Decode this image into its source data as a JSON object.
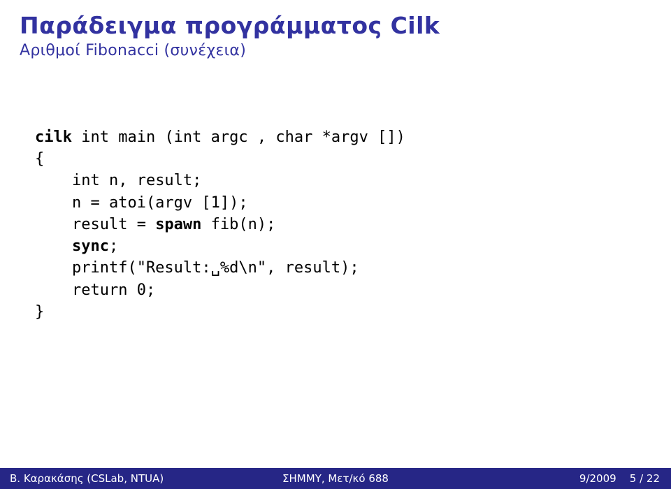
{
  "header": {
    "title": "Παράδειγμα προγράμματος Cilk",
    "subtitle": "Αριθμοί Fibonacci (συνέχεια)"
  },
  "code": {
    "l1a": "cilk",
    "l1b": " int",
    "l1c": " main (int",
    "l1d": " argc , char",
    "l1e": " *argv [])",
    "l2": "{",
    "l3a": "    int",
    "l3b": " n, result;",
    "l4": "    n = atoi(argv [1]);",
    "l5a": "    result = ",
    "l5b": "spawn",
    "l5c": " fib(n);",
    "l6a": "    ",
    "l6b": "sync",
    "l6c": ";",
    "l7": "    printf(\"Result:␣%d\\n\", result);",
    "l8a": "    return",
    "l8b": " 0;",
    "l9": "}"
  },
  "footer": {
    "left": "Β. Καρακάσης (CSLab, NTUA)",
    "center": "ΣΗΜΜΥ, Μετ/κό 688",
    "right": "9/2009",
    "page": "5 / 22"
  }
}
